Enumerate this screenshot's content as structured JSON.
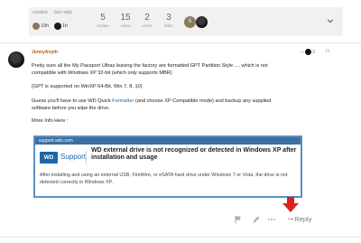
{
  "topic_map": {
    "created": {
      "label": "created",
      "time": "10h"
    },
    "last_reply": {
      "label": "last reply",
      "time": "1h"
    },
    "stats": [
      {
        "value": "5",
        "label": "replies"
      },
      {
        "value": "15",
        "label": "views"
      },
      {
        "value": "2",
        "label": "users"
      },
      {
        "value": "3",
        "label": "links"
      }
    ],
    "participant_badge": "5"
  },
  "post": {
    "author": "JonnyAnyth",
    "reply_to_number": "2",
    "time": "1h",
    "para1_a": "Pretty sure all the My Passport Ultras leaving the factory are formatted GPT Partition Style .... which is not",
    "para1_b": "compatible with Windows XP 32-bit (which only supports MBR)",
    "para2": "(GPT is supported on WinXP 64-Bit, Win 7, 8, 10)",
    "para3_a": "Guess you'll have to use WD Quick",
    "para3_link": "Formatter",
    "para3_b": "(and choose XP Compatible mode) and backup any supplied",
    "para3_c": "software before you wipe the drive.",
    "para4": "More Info Here :"
  },
  "onebox": {
    "domain": "support.wdc.com",
    "logo_text": "WD",
    "brand": "Support",
    "title": "WD external drive is not recognized or detected in Windows XP after installation and usage",
    "description": "After installing and using an external USB, FireWire, or eSATA hard drive under Windows 7 or Vista, the drive is not detected correctly in Windows XP."
  },
  "actions": {
    "reply_label": "Reply"
  },
  "colors": {
    "accent_link": "#1468a8",
    "author": "#b06010",
    "onebox_border": "#5b8fc4",
    "annotation_arrow": "#e02020"
  }
}
